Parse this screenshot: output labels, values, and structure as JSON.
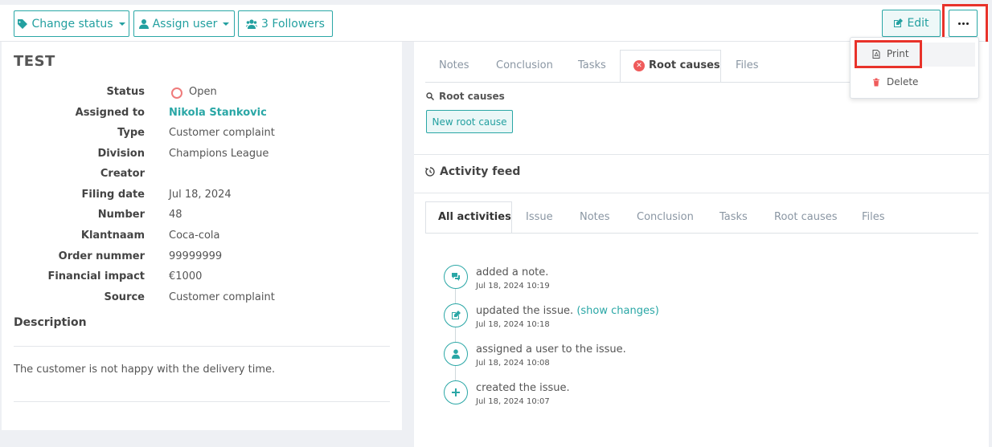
{
  "toolbar": {
    "change_status": "Change status",
    "assign_user": "Assign user",
    "followers": "3 Followers",
    "edit": "Edit"
  },
  "more_menu": {
    "print": "Print",
    "delete": "Delete"
  },
  "issue": {
    "title": "TEST",
    "fields": [
      {
        "label": "Status",
        "value": "Open"
      },
      {
        "label": "Assigned to",
        "value": "Nikola Stankovic"
      },
      {
        "label": "Type",
        "value": "Customer complaint"
      },
      {
        "label": "Division",
        "value": "Champions League"
      },
      {
        "label": "Creator",
        "value": ""
      },
      {
        "label": "Filing date",
        "value": "Jul 18, 2024"
      },
      {
        "label": "Number",
        "value": "48"
      },
      {
        "label": "Klantnaam",
        "value": "Coca-cola"
      },
      {
        "label": "Order nummer",
        "value": "99999999"
      },
      {
        "label": "Financial impact",
        "value": "€1000"
      },
      {
        "label": "Source",
        "value": "Customer complaint"
      }
    ],
    "description_heading": "Description",
    "description": "The customer is not happy with the delivery time."
  },
  "detail_tabs": [
    "Notes",
    "Conclusion",
    "Tasks",
    "Root causes",
    "Files"
  ],
  "root_causes": {
    "heading": "Root causes",
    "new_button": "New root cause"
  },
  "activity": {
    "heading": "Activity feed",
    "tabs": [
      "All activities",
      "Issue",
      "Notes",
      "Conclusion",
      "Tasks",
      "Root causes",
      "Files"
    ],
    "items": [
      {
        "icon": "comments-icon",
        "text": "added a note.",
        "time": "Jul 18, 2024 10:19"
      },
      {
        "icon": "edit-icon",
        "text": "updated the issue.",
        "link": "(show changes)",
        "time": "Jul 18, 2024 10:18"
      },
      {
        "icon": "user-icon",
        "text": "assigned a user to the issue.",
        "time": "Jul 18, 2024 10:08"
      },
      {
        "icon": "plus-icon",
        "text": "created the issue.",
        "time": "Jul 18, 2024 10:07"
      }
    ]
  },
  "colors": {
    "accent": "#2aa7a6",
    "highlight": "#e8322a",
    "status_open": "#ef7b7b",
    "error": "#ef5b5b"
  }
}
